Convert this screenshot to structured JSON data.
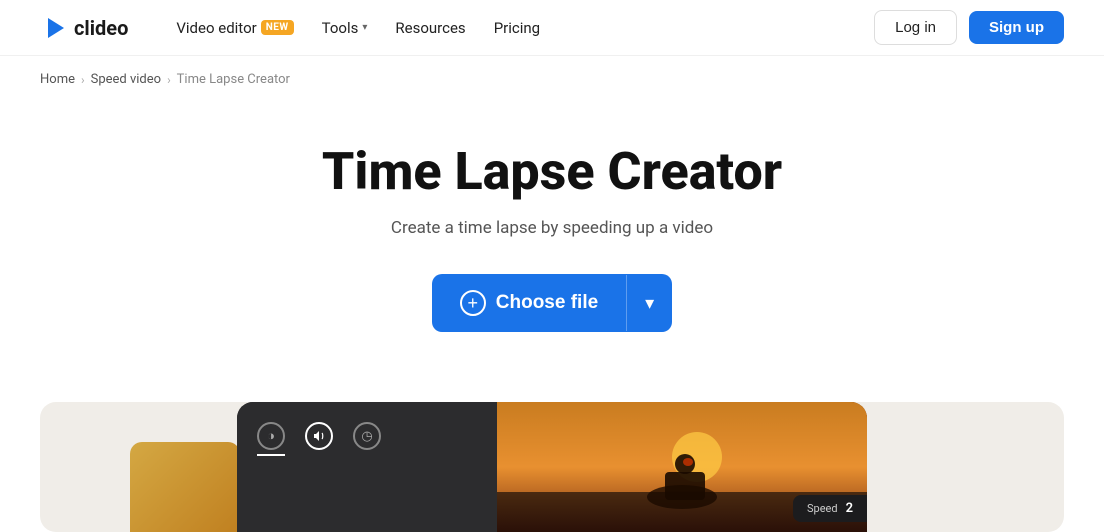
{
  "header": {
    "logo_text": "clideo",
    "nav": [
      {
        "id": "video-editor",
        "label": "Video editor",
        "badge": "NEW",
        "has_dropdown": false
      },
      {
        "id": "tools",
        "label": "Tools",
        "has_dropdown": true
      },
      {
        "id": "resources",
        "label": "Resources",
        "has_dropdown": false
      },
      {
        "id": "pricing",
        "label": "Pricing",
        "has_dropdown": false
      }
    ],
    "login_label": "Log in",
    "signup_label": "Sign up"
  },
  "breadcrumb": {
    "items": [
      {
        "id": "home",
        "label": "Home"
      },
      {
        "id": "speed-video",
        "label": "Speed video"
      },
      {
        "id": "current",
        "label": "Time Lapse Creator"
      }
    ]
  },
  "hero": {
    "title": "Time Lapse Creator",
    "subtitle": "Create a time lapse by speeding up a video",
    "choose_file_label": "Choose file",
    "choose_file_icon": "+"
  },
  "preview": {
    "speed_label": "Speed",
    "speed_value": "2"
  }
}
